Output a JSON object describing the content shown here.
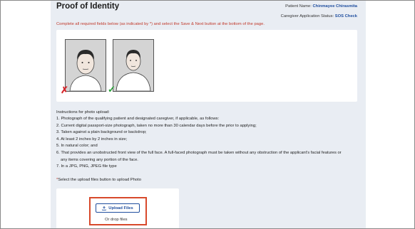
{
  "header": {
    "title": "Proof of Identity",
    "patient_label": "Patient Name:",
    "patient_value": "Chinmayee Chirasmita",
    "status_label": "Caregiver Application Status:",
    "status_value": "SOS Check"
  },
  "notice": "Complete all required fields below (as indicated by *) and select the Save & Next button at the bottom of the page.",
  "photo_examples": [
    {
      "status": "incorrect",
      "mark": "✗",
      "icon": "x-mark-icon"
    },
    {
      "status": "correct",
      "mark": "✓",
      "icon": "check-mark-icon"
    }
  ],
  "instructions": {
    "heading": "Instructions for photo upload:",
    "items": [
      "1. Photograph of the qualifying patient and designated caregiver, if applicable, as follows:",
      "2. Current digital passport-size photograph, taken no more than 30 calendar days before the prior to applying;",
      "3. Taken against a plain background or backdrop;",
      "4. At least 2 inches by 2 inches in size;",
      "5. In natural color; and",
      "6. That provides an unobstructed front view of the full face. A full-faced photograph must be taken without any obstruction of the applicant's facial features or",
      "    any items covering any portion of the face.",
      "7. In a JPG, PNG, JPEG file type"
    ]
  },
  "upload": {
    "required_mark": "*",
    "label": "Select the upload files button to upload Photo",
    "button_label": "Upload Files",
    "drop_text": "Or drop files"
  },
  "colors": {
    "accent": "#1f4e9e",
    "required": "#c0392b",
    "highlight": "#d8492b",
    "page_bg": "#e9edf3"
  }
}
